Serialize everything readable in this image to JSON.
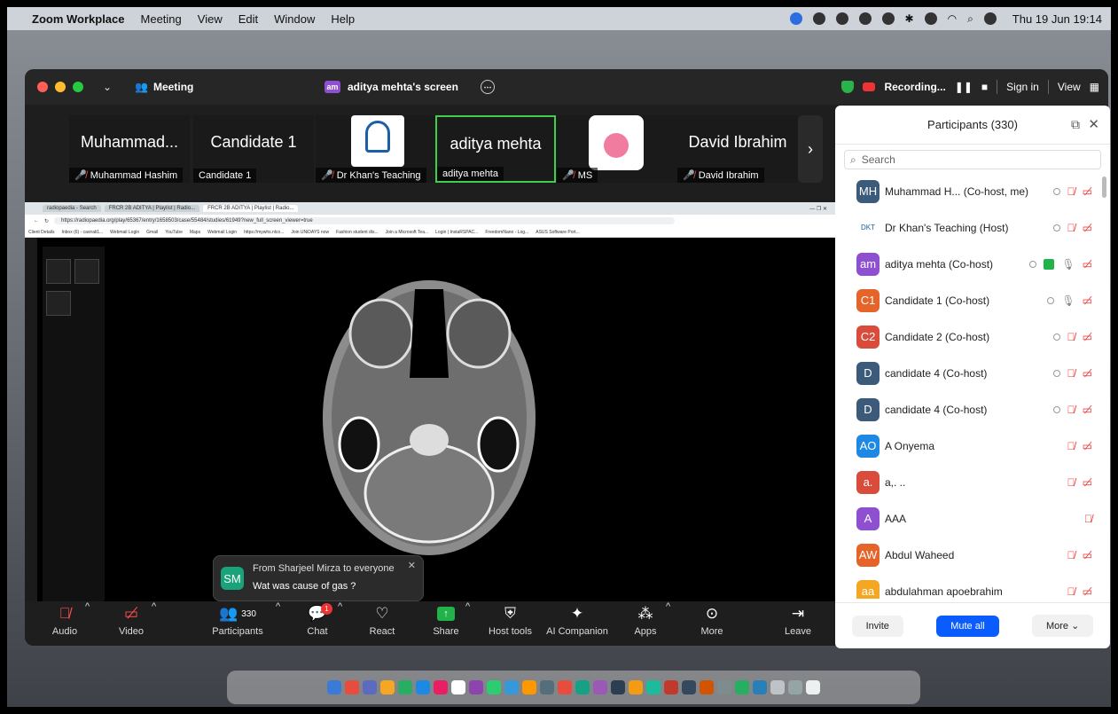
{
  "menubar": {
    "app": "Zoom Workplace",
    "items": [
      "Meeting",
      "View",
      "Edit",
      "Window",
      "Help"
    ],
    "datetime": "Thu 19 Jun  19:14"
  },
  "titlebar": {
    "meeting_label": "Meeting",
    "share_badge": "am",
    "share_title": "aditya mehta's screen",
    "recording_label": "Recording...",
    "signin_label": "Sign in",
    "view_label": "View"
  },
  "strip": {
    "tiles": [
      {
        "big": "Muhammad...",
        "tag": "Muhammad Hashim",
        "muted": true
      },
      {
        "big": "Candidate 1",
        "tag": "Candidate 1",
        "muted": false
      },
      {
        "big": "",
        "tag": "Dr Khan's Teaching",
        "muted": true
      },
      {
        "big": "aditya mehta",
        "tag": "aditya mehta",
        "muted": false
      },
      {
        "big": "",
        "tag": "MS",
        "muted": true
      },
      {
        "big": "David Ibrahim",
        "tag": "David Ibrahim",
        "muted": true
      }
    ]
  },
  "browser": {
    "tabs": [
      "radiopaedia - Search",
      "FRCR 2B ADITYA | Playlist | Radio...",
      "FRCR 2B ADITYA | Playlist | Radio..."
    ],
    "url": "https://radiopaedia.org/play/65367/entry/1658503/case/55484/studies/61949?new_full_screen_viewer=true",
    "bookmarks": [
      "Client Details",
      "Inbox (6) - cavirali1...",
      "Webmail Login",
      "Gmail",
      "YouTube",
      "Maps",
      "Webmail Login",
      "https://mywhs.nlco...",
      "Join UNiDAYS now",
      "Fashion student dis...",
      "Join a Microsoft Tea...",
      "Login | InstaRSPAC...",
      "FreedomNano - Log...",
      "ASUS Software Port..."
    ]
  },
  "toast": {
    "avatar": "SM",
    "from": "From Sharjeel Mirza to everyone",
    "message": "Wat was cause of gas ?"
  },
  "toolbar": {
    "audio": "Audio",
    "video": "Video",
    "participants": "Participants",
    "participants_count": "330",
    "chat": "Chat",
    "chat_badge": "1",
    "react": "React",
    "share": "Share",
    "host_tools": "Host tools",
    "ai_companion": "AI Companion",
    "apps": "Apps",
    "more": "More",
    "leave": "Leave"
  },
  "panel": {
    "title": "Participants (330)",
    "search_placeholder": "Search",
    "participants": [
      {
        "initials": "MH",
        "name": "Muhammad H... (Co-host, me)",
        "color": "#3c5a7a",
        "icons": [
          "cc",
          "mic-off",
          "video-off"
        ]
      },
      {
        "initials": "DKT",
        "name": "Dr Khan's Teaching (Host)",
        "color": "#ffffff",
        "icons": [
          "cc",
          "mic-off",
          "video-off"
        ]
      },
      {
        "initials": "am",
        "name": "aditya mehta (Co-host)",
        "color": "#8e4fd0",
        "icons": [
          "cc",
          "share",
          "mic",
          "video-off"
        ]
      },
      {
        "initials": "C1",
        "name": "Candidate 1 (Co-host)",
        "color": "#e4642a",
        "icons": [
          "cc",
          "mic",
          "video-off"
        ]
      },
      {
        "initials": "C2",
        "name": "Candidate 2 (Co-host)",
        "color": "#d94b3a",
        "icons": [
          "cc",
          "mic-off",
          "video-off"
        ]
      },
      {
        "initials": "D",
        "name": "candidate 4 (Co-host)",
        "color": "#3c5a7a",
        "icons": [
          "cc",
          "mic-off",
          "video-off"
        ]
      },
      {
        "initials": "D",
        "name": "candidate 4 (Co-host)",
        "color": "#3c5a7a",
        "icons": [
          "cc",
          "mic-off",
          "video-off"
        ]
      },
      {
        "initials": "AO",
        "name": "A Onyema",
        "color": "#1e88e5",
        "icons": [
          "mic-off",
          "video-off"
        ]
      },
      {
        "initials": "a.",
        "name": "a,. ..",
        "color": "#d94b3a",
        "icons": [
          "mic-off",
          "video-off"
        ]
      },
      {
        "initials": "A",
        "name": "AAA",
        "color": "#8e4fd0",
        "icons": [
          "mic-off"
        ]
      },
      {
        "initials": "AW",
        "name": "Abdul Waheed",
        "color": "#e4642a",
        "icons": [
          "mic-off",
          "video-off"
        ]
      },
      {
        "initials": "aa",
        "name": "abdulahman apoebrahim",
        "color": "#f5a623",
        "icons": [
          "mic-off",
          "video-off"
        ]
      }
    ],
    "invite": "Invite",
    "mute_all": "Mute all",
    "more": "More"
  }
}
